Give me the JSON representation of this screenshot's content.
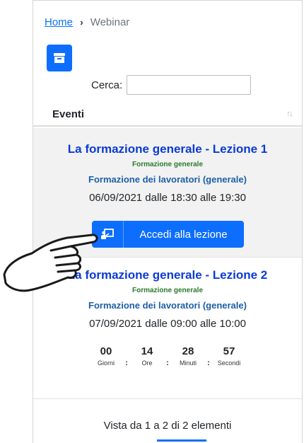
{
  "breadcrumb": {
    "home": "Home",
    "separator": "›",
    "current": "Webinar"
  },
  "search": {
    "label": "Cerca:",
    "value": ""
  },
  "table": {
    "header": "Eventi",
    "sort_icon": "sort-icon"
  },
  "events": [
    {
      "title": "La formazione generale - Lezione 1",
      "subtitle": "Formazione generale",
      "course": "Formazione dei lavoratori (generale)",
      "date": "06/09/2021 dalle 18:30 alle 19:30",
      "button": "Accedi alla lezione"
    },
    {
      "title": "La formazione generale - Lezione 2",
      "subtitle": "Formazione generale",
      "course": "Formazione dei lavoratori (generale)",
      "date": "07/09/2021 dalle 09:00 alle 10:00",
      "countdown": {
        "days": "00",
        "days_label": "Giorni",
        "hours": "14",
        "hours_label": "Ore",
        "minutes": "28",
        "minutes_label": "Minuti",
        "seconds": "57",
        "seconds_label": "Secondi",
        "separator": ":"
      }
    }
  ],
  "footer": {
    "info": "Vista da 1 a 2 di 2 elementi"
  },
  "colors": {
    "primary": "#0d6efd",
    "title": "#0a3bd6",
    "subtitle": "#2a7a2a",
    "course": "#1d5fa8"
  }
}
